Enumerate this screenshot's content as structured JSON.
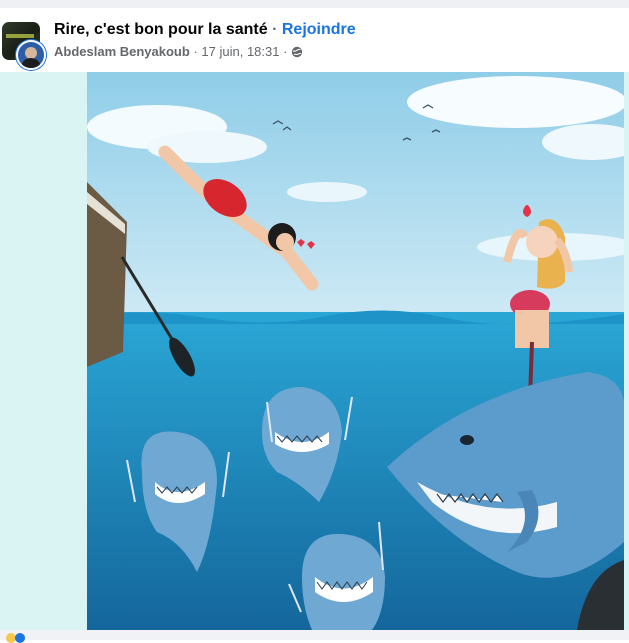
{
  "post": {
    "group_name": "Rire, c'est bon pour la santé",
    "separator": "·",
    "join_label": "Rejoindre",
    "author": "Abdeslam Benyakoub",
    "timestamp": "17 juin, 18:31",
    "meta_separator": "·",
    "privacy_icon": "globe-icon"
  },
  "colors": {
    "link": "#1b74e4",
    "page_bg": "#d9f4f3",
    "sky": "#9fd6ec",
    "sea": "#1f8fc4",
    "shark": "#5c9ccc"
  }
}
